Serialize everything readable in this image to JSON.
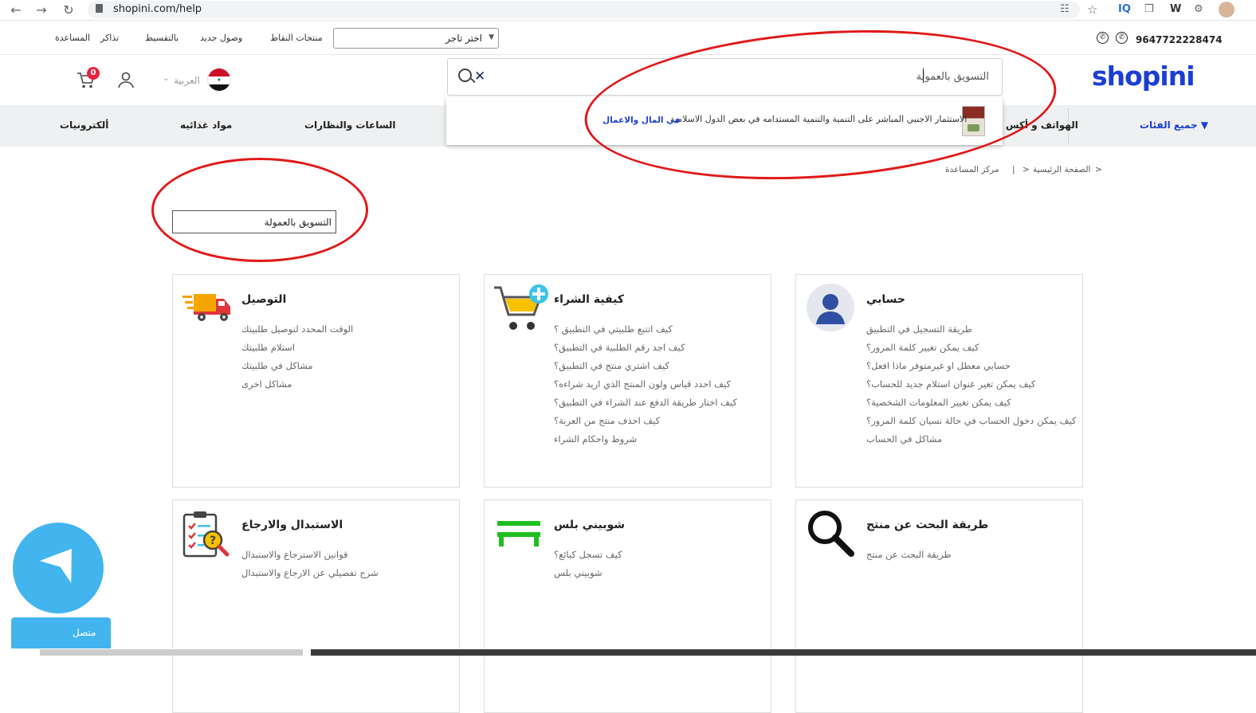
{
  "browser": {
    "url": "shopini.com/help",
    "extensions": [
      "translate-icon",
      "star-icon",
      "IQ",
      "copy-icon",
      "W",
      "puzzle-icon",
      "avatar"
    ]
  },
  "topbar": {
    "phone": "9647722228474",
    "links": [
      "منتجات النقاط",
      "وصول جديد",
      "بالتقسيط",
      "تذاكر",
      "المساعدة"
    ],
    "store_select": "اختر تاجر"
  },
  "header": {
    "logo": "shopini",
    "search_value": "التسويق بالعمولة",
    "language": "العربية",
    "cart_count": "0"
  },
  "search_suggestion": {
    "title": "الاستثمار الاجنبي المباشر على التنمية والتنمية المستدامه في بعض الدول الاسلامية",
    "category": "في المال والاعمال"
  },
  "categories": {
    "all": "جميع الفئات",
    "items": [
      "الهواتف و أكس",
      "الساعات والنظارات",
      "مواد غذائيه",
      "ألكترونيات"
    ]
  },
  "breadcrumb": {
    "home": "الصفحة الرئيسية",
    "current": "مركز المساعدة",
    "sep": ">",
    "bar": "|"
  },
  "help_search": {
    "value": "التسويق بالعمولة"
  },
  "cards": [
    {
      "title": "التوصيل",
      "icon": "truck-icon",
      "links": [
        "الوقت المحدد لتوصيل طلبيتك",
        "استلام طلبيتك",
        "مشاكل في طلبيتك",
        "مشاكل اخرى"
      ]
    },
    {
      "title": "كيفية الشراء",
      "icon": "cart-plus-icon",
      "links": [
        "كيف اتتبع طلبيتي في التطبيق ؟",
        "كيف اجد رقم الطلبية في التطبيق؟",
        "كيف اشتري منتج في التطبيق؟",
        "كيف احدد قياس ولون المنتج الذي اريد شراءه؟",
        "كيف اختار طريقة الدفع عند الشراء في التطبيق؟",
        "كيف احذف منتج من العربة؟",
        "شروط واحكام الشراء"
      ]
    },
    {
      "title": "حسابي",
      "icon": "user-avatar-icon",
      "links": [
        "طريقة التسجيل في التطبيق",
        "كيف يمكن تغيير كلمة المرور؟",
        "حسابي معطل او غيرمتوفر ماذا افعل؟",
        "كيف يمكن تغير عنوان استلام جديد للحساب؟",
        "كيف يمكن تغيير المعلومات الشخصية؟",
        "كيف يمكن دخول الحساب في حالة نسيان كلمة المرور؟",
        "مشاكل في الحساب"
      ]
    },
    {
      "title": "الاستبدال والارجاع",
      "icon": "clipboard-search-icon",
      "links": [
        "قوانين الاسترجاع والاستبدال",
        "شرح تفصيلي عن الارجاع والاستبدال"
      ]
    },
    {
      "title": "شوبيني بلس",
      "icon": "shopini-plus-icon",
      "links": [
        "كيف تسجل كبائع؟",
        "شوبيني بلس"
      ]
    },
    {
      "title": "طريقة البحث عن منتج",
      "icon": "magnifier-icon",
      "links": [
        "طريقة البحث عن منتج"
      ]
    }
  ],
  "chat": {
    "label": "متصل"
  },
  "colors": {
    "brand": "#1b3fd1",
    "annotation": "#e01919",
    "chat": "#43b5ee",
    "badge": "#e8233f"
  }
}
